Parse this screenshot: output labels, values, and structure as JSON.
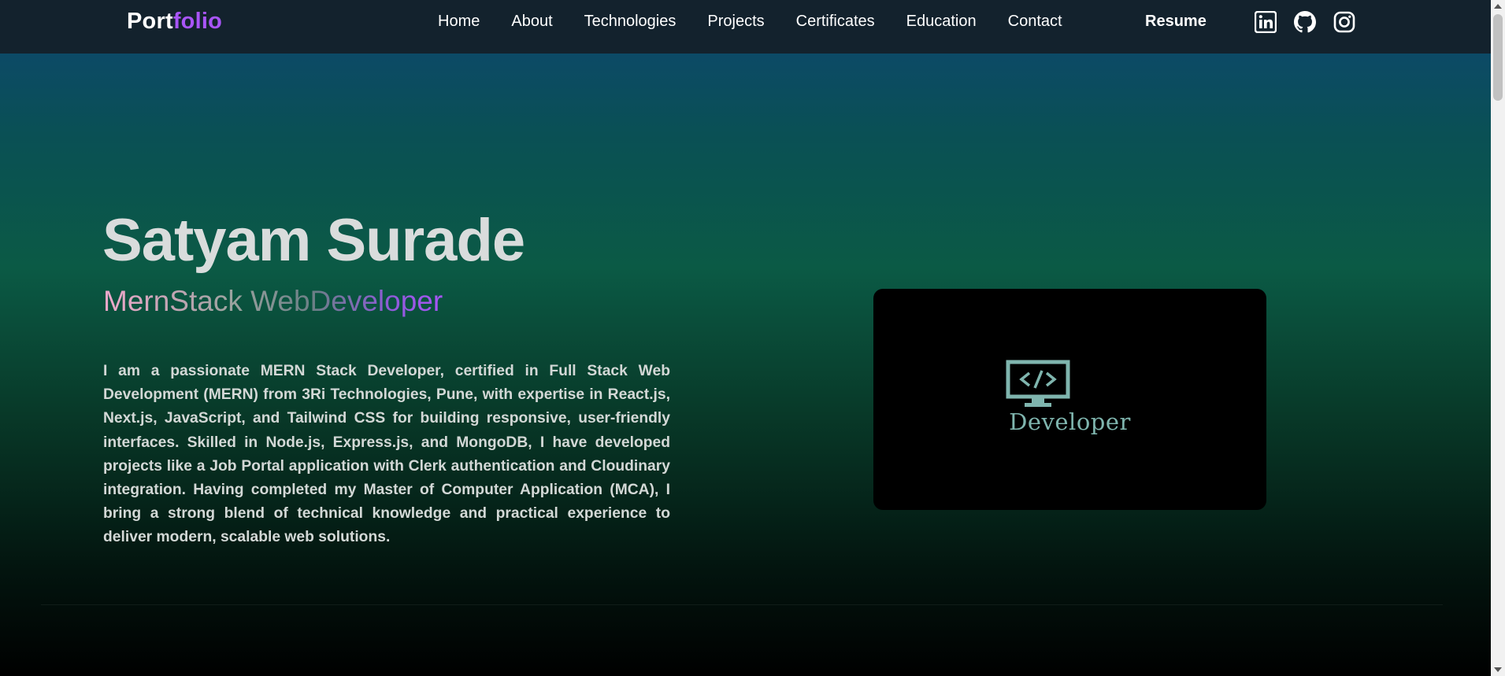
{
  "nav": {
    "logo_part1": "Port",
    "logo_part2": "folio",
    "links": [
      "Home",
      "About",
      "Technologies",
      "Projects",
      "Certificates",
      "Education",
      "Contact"
    ],
    "resume": "Resume",
    "socials": [
      "linkedin-icon",
      "github-icon",
      "instagram-icon"
    ]
  },
  "hero": {
    "name": "Satyam Surade",
    "title": "MernStack WebDeveloper",
    "description": "I am a passionate MERN Stack Developer, certified in Full Stack Web Development (MERN) from 3Ri Technologies, Pune, with expertise in React.js, Next.js, JavaScript, and Tailwind CSS for building responsive, user-friendly interfaces. Skilled in Node.js, Express.js, and MongoDB, I have developed projects like a Job Portal application with Clerk authentication and Cloudinary integration. Having completed my Master of Computer Application (MCA), I bring a strong blend of technical knowledge and practical experience to deliver modern, scalable web solutions."
  },
  "card": {
    "icon": "monitor-code-icon",
    "label": "Developer"
  },
  "colors": {
    "accent": "#a855f7",
    "navbar_bg": "#13222d",
    "card_icon": "#7fb5ae"
  }
}
